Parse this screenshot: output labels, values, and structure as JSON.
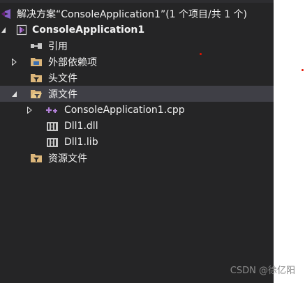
{
  "solution_explorer": {
    "solution_root": "解决方案“ConsoleApplication1”(1 个项目/共 1 个)",
    "project": "ConsoleApplication1",
    "items": {
      "references": "引用",
      "external_deps": "外部依赖项",
      "header_files": "头文件",
      "source_files": "源文件",
      "cpp_file": "ConsoleApplication1.cpp",
      "dll_file": "Dll1.dll",
      "lib_file": "Dll1.lib",
      "resource_files": "资源文件"
    }
  },
  "watermark": "CSDN @徐亿阳",
  "colors": {
    "panel_bg": "#252526",
    "selected_row": "#3f3f46",
    "text": "#f1f1f1",
    "folder": "#dcb67a",
    "vs_purple": "#68217a",
    "cpp_purple": "#b180d7",
    "red_dot": "#e51400"
  }
}
